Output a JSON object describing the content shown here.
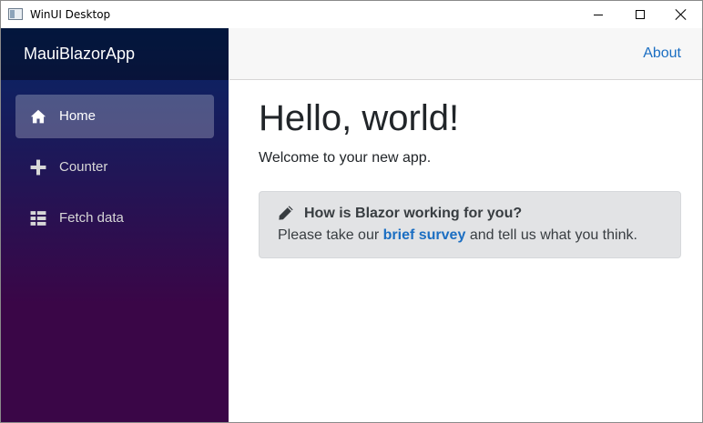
{
  "window": {
    "title": "WinUI Desktop",
    "controls": {
      "minimize": "minimize-icon",
      "maximize": "maximize-icon",
      "close": "close-icon"
    }
  },
  "sidebar": {
    "brand": "MauiBlazorApp",
    "items": [
      {
        "label": "Home",
        "icon": "home-icon",
        "active": true
      },
      {
        "label": "Counter",
        "icon": "plus-icon",
        "active": false
      },
      {
        "label": "Fetch data",
        "icon": "list-icon",
        "active": false
      }
    ]
  },
  "top_row": {
    "about": "About"
  },
  "main": {
    "heading": "Hello, world!",
    "welcome": "Welcome to your new app.",
    "survey": {
      "icon": "pencil-icon",
      "title": "How is Blazor working for you?",
      "text_before": "Please take our",
      "link": "brief survey",
      "text_after": "and tell us what you think."
    }
  },
  "colors": {
    "sidebar_top": "#052767",
    "sidebar_bottom": "#3a0647",
    "link": "#1b6ec2",
    "survey_bg": "#e2e3e5",
    "text": "#212529"
  }
}
